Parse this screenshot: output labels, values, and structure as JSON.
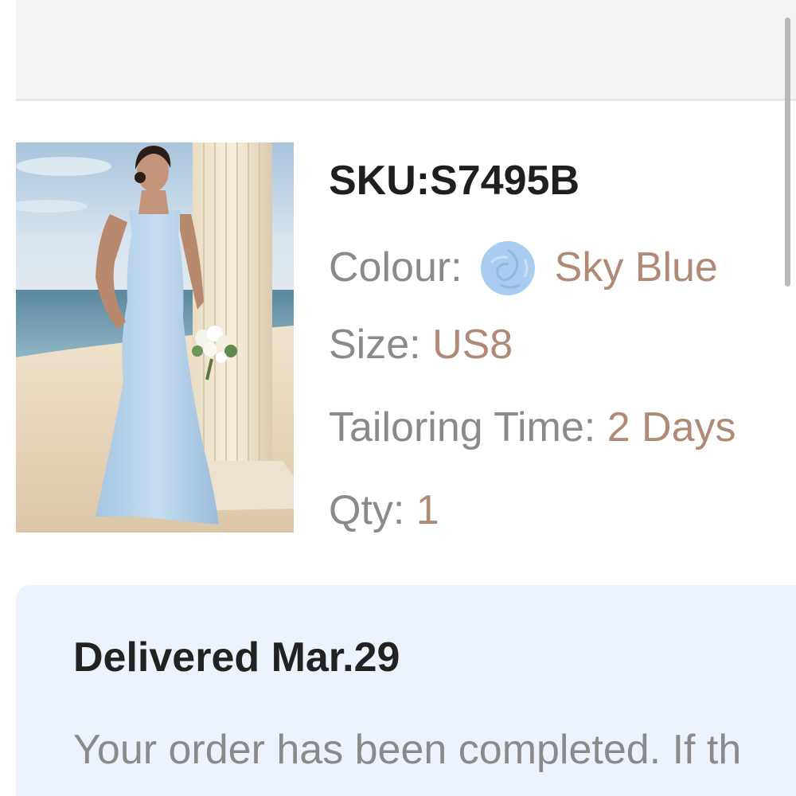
{
  "product": {
    "sku": "SKU:S7495B",
    "colour_label": "Colour:",
    "colour_value": "Sky Blue",
    "swatch_color": "#a9cdf0",
    "size_label": "Size:",
    "size_value": "US8",
    "tailoring_label": "Tailoring Time:",
    "tailoring_value": "2 Days",
    "qty_label": "Qty:",
    "qty_value": "1",
    "image_alt": "Woman in sky blue bridesmaid dress on beach"
  },
  "delivery": {
    "title": "Delivered Mar.29",
    "message": "Your order has been completed. If th"
  },
  "colors": {
    "value_accent": "#b08a76",
    "label_gray": "#8a8a8a",
    "card_background": "#ecf3fc"
  }
}
